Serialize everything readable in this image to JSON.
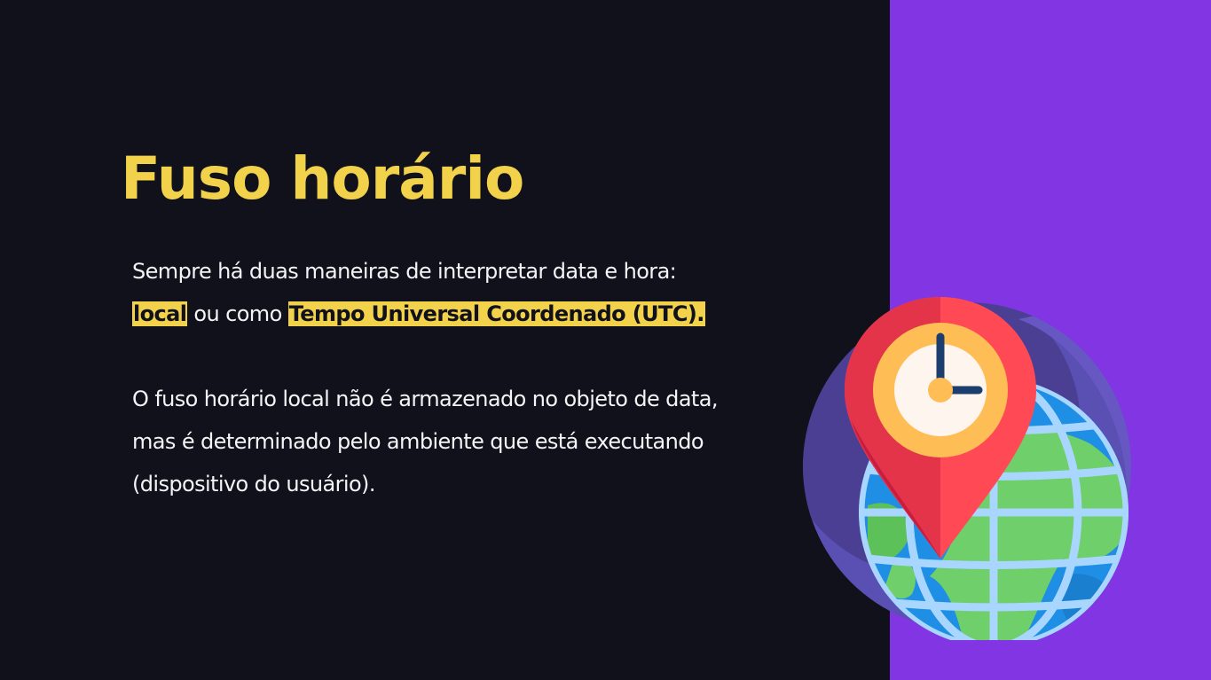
{
  "slide": {
    "title": "Fuso horário",
    "paragraph1": {
      "line1": "Sempre há duas maneiras de interpretar data e hora:",
      "highlight_local": "local",
      "connector": " ou como ",
      "highlight_utc": "Tempo Universal Coordenado (UTC)."
    },
    "paragraph2": {
      "line1": "O fuso horário local não é armazenado no objeto de data,",
      "line2": "mas é determinado pelo ambiente que está executando",
      "line3": "(dispositivo do usuário)."
    }
  },
  "colors": {
    "background": "#10111b",
    "accent_panel": "#8135e3",
    "title": "#f2d14b",
    "highlight": "#f2d14b",
    "body_text": "#f4f4f6"
  },
  "illustration": {
    "icon": "globe-location-pin-clock-icon"
  }
}
